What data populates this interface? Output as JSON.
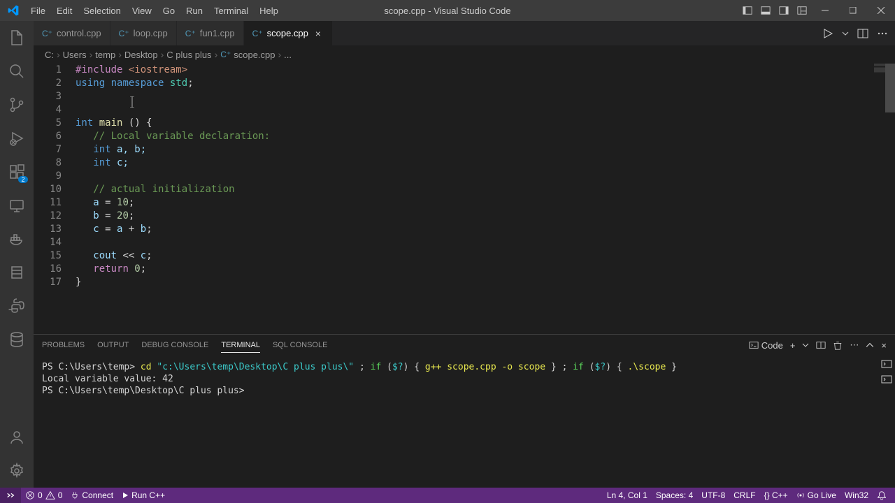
{
  "title": "scope.cpp - Visual Studio Code",
  "menu": [
    "File",
    "Edit",
    "Selection",
    "View",
    "Go",
    "Run",
    "Terminal",
    "Help"
  ],
  "tabs": [
    {
      "label": "control.cpp",
      "active": false
    },
    {
      "label": "loop.cpp",
      "active": false
    },
    {
      "label": "fun1.cpp",
      "active": false
    },
    {
      "label": "scope.cpp",
      "active": true
    }
  ],
  "breadcrumb": {
    "parts": [
      "C:",
      "Users",
      "temp",
      "Desktop",
      "C plus plus"
    ],
    "file": "scope.cpp",
    "trail": "..."
  },
  "code": {
    "lines": [
      {
        "n": 1
      },
      {
        "n": 2
      },
      {
        "n": 3
      },
      {
        "n": 4
      },
      {
        "n": 5
      },
      {
        "n": 6
      },
      {
        "n": 7
      },
      {
        "n": 8
      },
      {
        "n": 9
      },
      {
        "n": 10
      },
      {
        "n": 11
      },
      {
        "n": 12
      },
      {
        "n": 13
      },
      {
        "n": 14
      },
      {
        "n": 15
      },
      {
        "n": 16
      },
      {
        "n": 17
      }
    ],
    "tok": {
      "include": "#include",
      "iostream": "<iostream>",
      "using": "using",
      "namespace": "namespace",
      "std": "std",
      "int": "int",
      "main": "main",
      "parens": "()",
      "obrace": " {",
      "comment1": "// Local variable declaration:",
      "ab": " a, b;",
      "c": " c;",
      "comment2": "// actual initialization",
      "a10": "a = 10;",
      "b20": "b = 20;",
      "cab": "c = a + b;",
      "cout": "cout << c;",
      "return": "return",
      "zero": " 0",
      "semi": ";",
      "cbrace": "}",
      "ten": "10",
      "twenty": "20"
    }
  },
  "panel": {
    "tabs": [
      "PROBLEMS",
      "OUTPUT",
      "DEBUG CONSOLE",
      "TERMINAL",
      "SQL CONSOLE"
    ],
    "active": "TERMINAL",
    "selector": "Code",
    "terminal": {
      "prompt1": "PS C:\\Users\\temp> ",
      "cd": "cd ",
      "path": "\"c:\\Users\\temp\\Desktop\\C plus plus\\\"",
      "sep": " ; ",
      "if1": "if",
      "paren1": " (",
      "cond": "$?",
      "paren2": ") { ",
      "gpp": "g++ scope.cpp -o scope",
      "brace2": " } ; ",
      "if2": "if",
      "run": ".\\scope",
      "brace3": " }",
      "output": "Local variable value: 42",
      "prompt2": "PS C:\\Users\\temp\\Desktop\\C plus plus>"
    }
  },
  "status": {
    "errors": "0",
    "warnings": "0",
    "connect": "Connect",
    "run": "Run C++",
    "cursor": "Ln 4, Col 1",
    "spaces": "Spaces: 4",
    "encoding": "UTF-8",
    "eol": "CRLF",
    "lang": "{} C++",
    "golive": "Go Live",
    "win32": "Win32"
  },
  "activity": {
    "ext_badge": "2"
  }
}
